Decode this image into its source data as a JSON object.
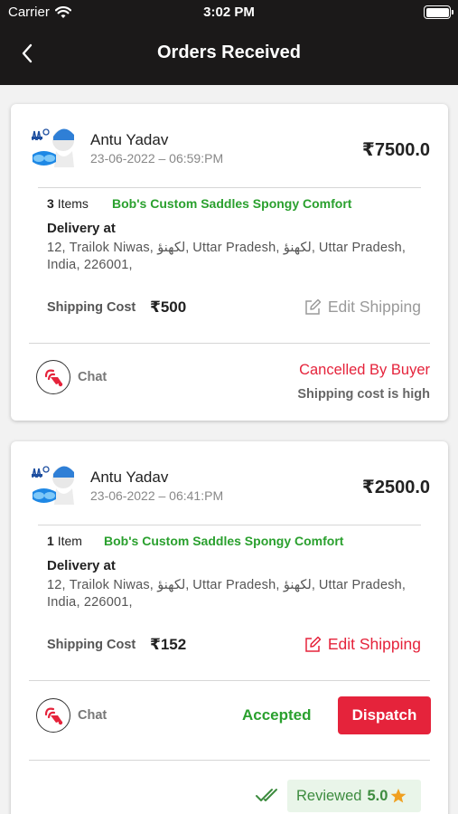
{
  "status_bar": {
    "carrier": "Carrier",
    "time": "3:02 PM"
  },
  "nav": {
    "title": "Orders Received"
  },
  "orders": [
    {
      "buyer": "Antu Yadav",
      "datetime": "23-06-2022 – 06:59:PM",
      "price": "₹7500.0",
      "item_count": "3",
      "item_unit": "Items",
      "product": "Bob's Custom Saddles Spongy Comfort",
      "delivery_label": "Delivery at",
      "address": "12, Trailok Niwas, لکھنؤ, Uttar Pradesh, لکھنؤ, Uttar Pradesh, India, 226001,",
      "shipping_label": "Shipping Cost",
      "shipping_value": "₹500",
      "edit_shipping_label": "Edit Shipping",
      "chat_label": "Chat",
      "status": "Cancelled By Buyer",
      "status_reason": "Shipping cost is high"
    },
    {
      "buyer": "Antu Yadav",
      "datetime": "23-06-2022 – 06:41:PM",
      "price": "₹2500.0",
      "item_count": "1",
      "item_unit": "Item",
      "product": "Bob's Custom Saddles Spongy Comfort",
      "delivery_label": "Delivery at",
      "address": "12, Trailok Niwas, لکھنؤ, Uttar Pradesh, لکھنؤ, Uttar Pradesh, India, 226001,",
      "shipping_label": "Shipping Cost",
      "shipping_value": "₹152",
      "edit_shipping_label": "Edit Shipping",
      "chat_label": "Chat",
      "status": "Accepted",
      "dispatch_label": "Dispatch",
      "review_label": "Reviewed",
      "review_score": "5.0"
    }
  ],
  "icons": {
    "wifi": "wifi-icon",
    "battery": "battery-icon",
    "back": "chevron-left-icon",
    "edit": "edit-icon",
    "chat": "chat-icon",
    "check": "double-check-icon",
    "star": "star-icon"
  },
  "colors": {
    "topbar": "#1b1919",
    "accent_red": "#e5233b",
    "green": "#2aa02e",
    "star": "#f0a020"
  }
}
